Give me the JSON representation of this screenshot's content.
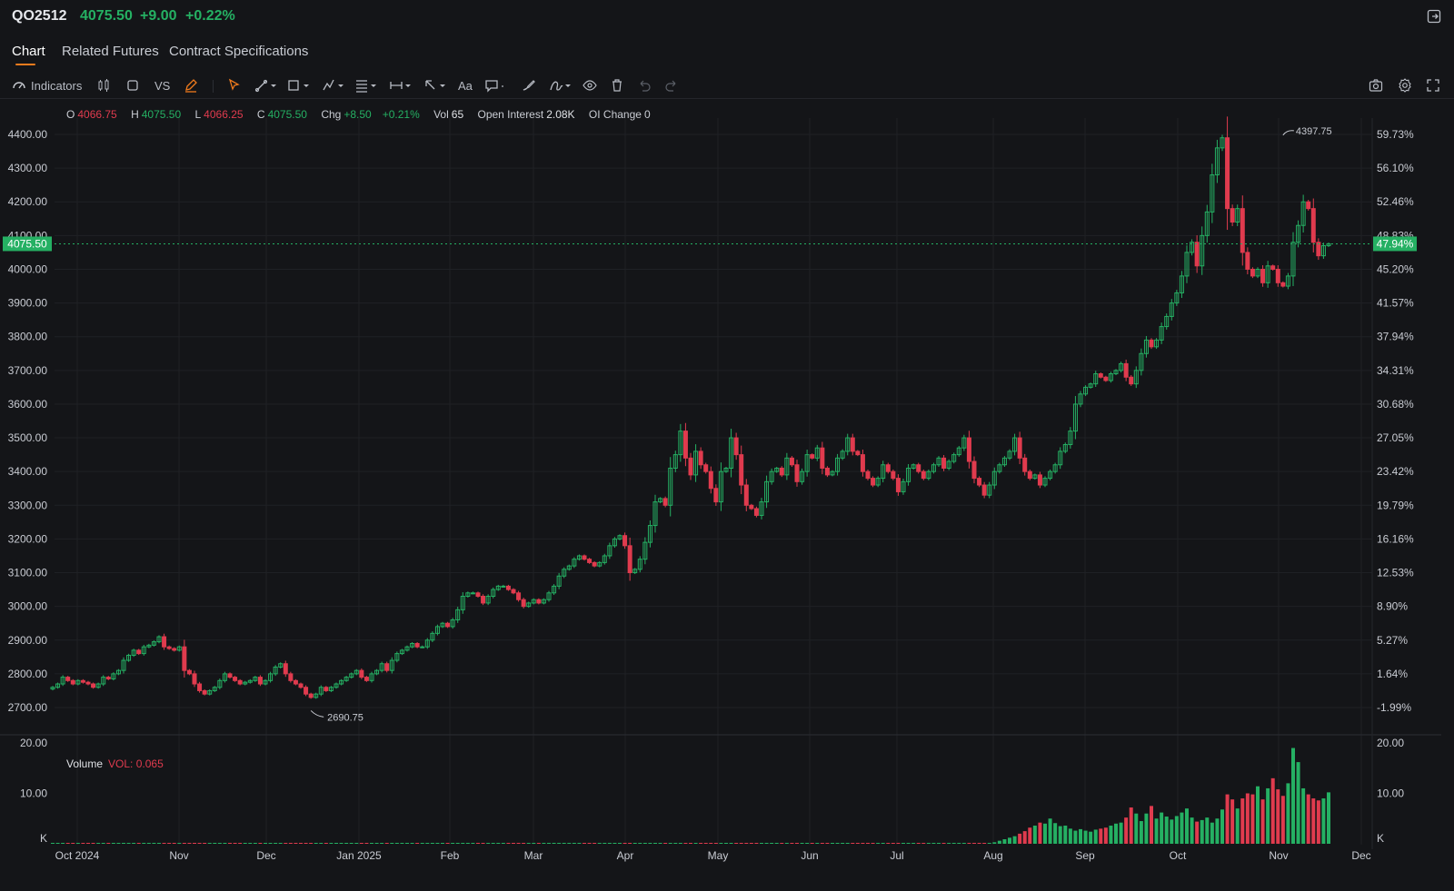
{
  "header": {
    "symbol": "QO2512",
    "price": "4075.50",
    "change": "+9.00",
    "change_pct": "+0.22%",
    "colors": {
      "up": "#25b063",
      "down": "#e03b4e",
      "accent": "#f07b1d"
    }
  },
  "tabs": [
    {
      "label": "Chart",
      "active": true
    },
    {
      "label": "Related Futures",
      "active": false
    },
    {
      "label": "Contract Specifications",
      "active": false
    }
  ],
  "toolbar": {
    "indicators_label": "Indicators",
    "vs_label": "VS",
    "text_tool_label": "Aa",
    "icons": [
      "indicators-icon",
      "candle-type-icon",
      "square-icon",
      "vs",
      "pencil-icon",
      "cursor-icon",
      "trendline-icon",
      "shape-icon",
      "pattern-icon",
      "fib-icon",
      "measure-icon",
      "arrow-icon",
      "text-icon",
      "comment-icon",
      "brush-icon",
      "signature-icon",
      "eye-icon",
      "trash-icon",
      "undo-icon",
      "redo-icon",
      "camera-icon",
      "settings-icon",
      "fullscreen-icon"
    ]
  },
  "ohlc": {
    "o_label": "O",
    "o": "4066.75",
    "h_label": "H",
    "h": "4075.50",
    "l_label": "L",
    "l": "4066.25",
    "c_label": "C",
    "c": "4075.50",
    "chg_label": "Chg",
    "chg": "+8.50",
    "chg_pct": "+0.21%",
    "vol_label": "Vol",
    "vol": "65",
    "oi_label": "Open Interest",
    "oi": "2.08K",
    "oic_label": "OI Change",
    "oic": "0"
  },
  "volume_panel": {
    "label": "Volume",
    "vol_label": "VOL: 0.065"
  },
  "chart_data": {
    "type": "candlestick",
    "price_axis": {
      "ticks": [
        4400,
        4300,
        4200,
        4100,
        4000,
        3900,
        3800,
        3700,
        3600,
        3500,
        3400,
        3300,
        3200,
        3100,
        3000,
        2900,
        2800,
        2700
      ],
      "labels": [
        "4400.00",
        "4300.00",
        "4200.00",
        "4100.00",
        "4000.00",
        "3900.00",
        "3800.00",
        "3700.00",
        "3600.00",
        "3500.00",
        "3400.00",
        "3300.00",
        "3200.00",
        "3100.00",
        "3000.00",
        "2900.00",
        "2800.00",
        "2700.00"
      ],
      "ylim": [
        2640,
        4470
      ]
    },
    "pct_axis": [
      "59.73%",
      "56.10%",
      "52.46%",
      "48.83%",
      "45.20%",
      "41.57%",
      "37.94%",
      "34.31%",
      "30.68%",
      "27.05%",
      "23.42%",
      "19.79%",
      "16.16%",
      "12.53%",
      "8.90%",
      "5.27%",
      "1.64%",
      "-1.99%"
    ],
    "current_price": {
      "value": 4075.5,
      "label": "4075.50",
      "pct_label": "47.94%"
    },
    "high_marker": {
      "value": 4397.75,
      "label": "4397.75"
    },
    "low_marker": {
      "value": 2690.75,
      "label": "2690.75"
    },
    "time_axis": [
      "Oct 2024",
      "Nov",
      "Dec",
      "Jan 2025",
      "Feb",
      "Mar",
      "Apr",
      "May",
      "Jun",
      "Jul",
      "Aug",
      "Sep",
      "Oct",
      "Nov",
      "Dec"
    ],
    "volume_axis": {
      "labels": [
        "20.00",
        "10.00",
        "K"
      ],
      "ylim": [
        0,
        20
      ]
    },
    "close": [
      2760,
      2770,
      2790,
      2780,
      2770,
      2780,
      2775,
      2770,
      2760,
      2770,
      2790,
      2785,
      2800,
      2810,
      2840,
      2855,
      2870,
      2860,
      2880,
      2885,
      2895,
      2910,
      2880,
      2875,
      2870,
      2880,
      2810,
      2800,
      2770,
      2750,
      2740,
      2750,
      2760,
      2780,
      2800,
      2790,
      2780,
      2770,
      2775,
      2780,
      2790,
      2770,
      2780,
      2800,
      2820,
      2830,
      2800,
      2780,
      2770,
      2760,
      2740,
      2730,
      2740,
      2760,
      2750,
      2760,
      2770,
      2780,
      2790,
      2800,
      2810,
      2790,
      2780,
      2800,
      2810,
      2830,
      2810,
      2840,
      2860,
      2870,
      2880,
      2890,
      2880,
      2880,
      2900,
      2920,
      2940,
      2950,
      2940,
      2960,
      2990,
      3030,
      3040,
      3040,
      3030,
      3010,
      3030,
      3050,
      3060,
      3060,
      3050,
      3040,
      3020,
      3000,
      3010,
      3020,
      3010,
      3020,
      3040,
      3060,
      3090,
      3110,
      3120,
      3140,
      3150,
      3140,
      3130,
      3120,
      3130,
      3150,
      3180,
      3200,
      3210,
      3180,
      3100,
      3110,
      3140,
      3190,
      3240,
      3310,
      3320,
      3300,
      3410,
      3450,
      3520,
      3440,
      3390,
      3460,
      3420,
      3400,
      3350,
      3310,
      3400,
      3410,
      3500,
      3450,
      3360,
      3300,
      3290,
      3270,
      3310,
      3370,
      3400,
      3410,
      3390,
      3440,
      3420,
      3370,
      3400,
      3450,
      3440,
      3470,
      3410,
      3390,
      3400,
      3440,
      3460,
      3500,
      3460,
      3450,
      3400,
      3380,
      3360,
      3380,
      3420,
      3400,
      3380,
      3340,
      3370,
      3410,
      3420,
      3400,
      3380,
      3400,
      3420,
      3440,
      3410,
      3430,
      3450,
      3470,
      3500,
      3430,
      3380,
      3360,
      3330,
      3360,
      3400,
      3420,
      3440,
      3460,
      3500,
      3440,
      3400,
      3380,
      3390,
      3360,
      3380,
      3400,
      3420,
      3460,
      3480,
      3520,
      3600,
      3630,
      3650,
      3660,
      3690,
      3680,
      3670,
      3690,
      3700,
      3720,
      3680,
      3660,
      3700,
      3750,
      3790,
      3770,
      3790,
      3830,
      3860,
      3900,
      3930,
      3980,
      4050,
      4080,
      4010,
      4100,
      4170,
      4280,
      4360,
      4390,
      4180,
      4140,
      4180,
      4050,
      4000,
      3980,
      4000,
      3960,
      4010,
      4000,
      3960,
      3950,
      3980,
      4080,
      4130,
      4200,
      4180,
      4080,
      4040,
      4070,
      4075.5
    ],
    "volume": [
      0,
      0,
      0,
      0,
      0,
      0,
      0,
      0,
      0,
      0,
      0,
      0,
      0,
      0,
      0,
      0,
      0,
      0,
      0,
      0,
      0,
      0,
      0,
      0,
      0,
      0,
      0,
      0,
      0,
      0,
      0,
      0,
      0,
      0,
      0,
      0,
      0,
      0,
      0,
      0,
      0,
      0,
      0,
      0,
      0,
      0,
      0,
      0,
      0,
      0,
      0,
      0,
      0,
      0,
      0,
      0,
      0,
      0,
      0,
      0,
      0,
      0,
      0,
      0,
      0,
      0,
      0,
      0,
      0,
      0,
      0,
      0,
      0,
      0,
      0,
      0,
      0,
      0,
      0,
      0,
      0,
      0,
      0,
      0,
      0,
      0,
      0,
      0,
      0,
      0,
      0,
      0,
      0,
      0,
      0,
      0,
      0,
      0,
      0,
      0,
      0,
      0,
      0,
      0,
      0,
      0,
      0,
      0,
      0,
      0,
      0,
      0,
      0,
      0,
      0,
      0,
      0,
      0,
      0,
      0,
      0,
      0,
      0,
      0,
      0,
      0,
      0,
      0,
      0,
      0,
      0,
      0,
      0,
      0,
      0,
      0,
      0,
      0,
      0,
      0,
      0,
      0,
      0,
      0,
      0,
      0,
      0,
      0,
      0,
      0,
      0,
      0,
      0,
      0,
      0,
      0,
      0,
      0,
      0,
      0,
      0,
      0,
      0,
      0,
      0,
      0,
      0,
      0,
      0,
      0,
      0,
      0,
      0,
      0,
      0,
      0,
      0,
      0,
      0,
      0,
      0,
      0,
      0,
      0,
      0,
      0,
      0.3,
      0.6,
      0.9,
      1.2,
      1.5,
      2.0,
      2.5,
      3.2,
      3.6,
      4.2,
      4.0,
      5.0,
      4.1,
      3.5,
      3.6,
      3.0,
      2.6,
      2.9,
      2.6,
      2.4,
      2.8,
      3.0,
      3.2,
      3.6,
      4.0,
      4.2,
      5.2,
      7.2,
      6.0,
      4.5,
      6.0,
      7.5,
      5.0,
      6.2,
      5.4,
      4.8,
      5.5,
      6.2,
      7.0,
      5.2,
      4.4,
      4.7,
      5.2,
      4.2,
      5.0,
      6.8,
      9.8,
      8.8,
      7.0,
      9.0,
      10.0,
      9.8,
      11.4,
      8.8,
      11.0,
      13.0,
      10.8,
      9.5,
      12.0,
      19.0,
      16.2,
      11.0,
      9.8,
      9.0,
      8.6,
      9.0,
      10.2,
      8.8,
      9.2,
      10.6,
      7.8,
      5.0,
      4.6,
      7.4,
      6.0,
      8.2,
      9.2,
      7.6,
      7.9
    ]
  }
}
